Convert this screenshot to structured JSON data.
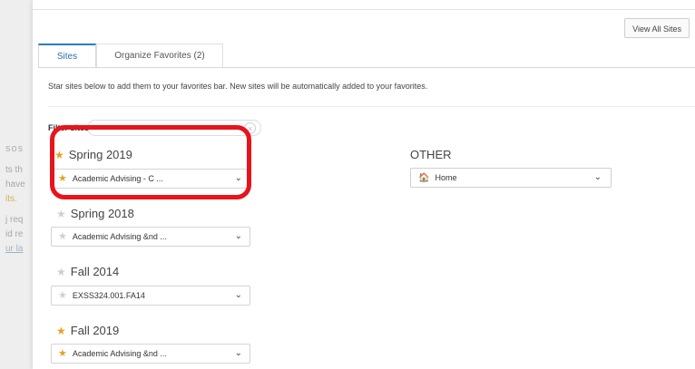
{
  "background": {
    "fragments": [
      "sos",
      "ts th",
      "have",
      "its.",
      "j req",
      "id re",
      "ur la"
    ]
  },
  "header": {
    "view_all_label": "View All Sites"
  },
  "tabs": [
    {
      "label": "Sites",
      "active": true
    },
    {
      "label": "Organize Favorites (2)",
      "active": false
    }
  ],
  "instructions": "Star sites below to add them to your favorites bar. New sites will be automatically added to your favorites.",
  "filter": {
    "label": "Filter sites",
    "value": ""
  },
  "groups": [
    {
      "title": "Spring 2019",
      "title_starred": true,
      "site": "Academic Advising - C ...",
      "site_starred": true
    },
    {
      "title": "Spring 2018",
      "title_starred": false,
      "site": "Academic Advising &nd ...",
      "site_starred": false
    },
    {
      "title": "Fall 2014",
      "title_starred": false,
      "site": "EXSS324.001.FA14",
      "site_starred": false
    },
    {
      "title": "Fall 2019",
      "title_starred": true,
      "site": "Academic Advising &nd ...",
      "site_starred": true
    }
  ],
  "other": {
    "title": "OTHER",
    "home_label": "Home"
  },
  "colors": {
    "accent": "#2a7cc0",
    "star_favorite": "#e8a221",
    "star_empty": "#cfcfcf",
    "highlight": "#e8141c"
  },
  "icons": {
    "star": "★",
    "chevron": "⌄",
    "home": "🏠"
  }
}
